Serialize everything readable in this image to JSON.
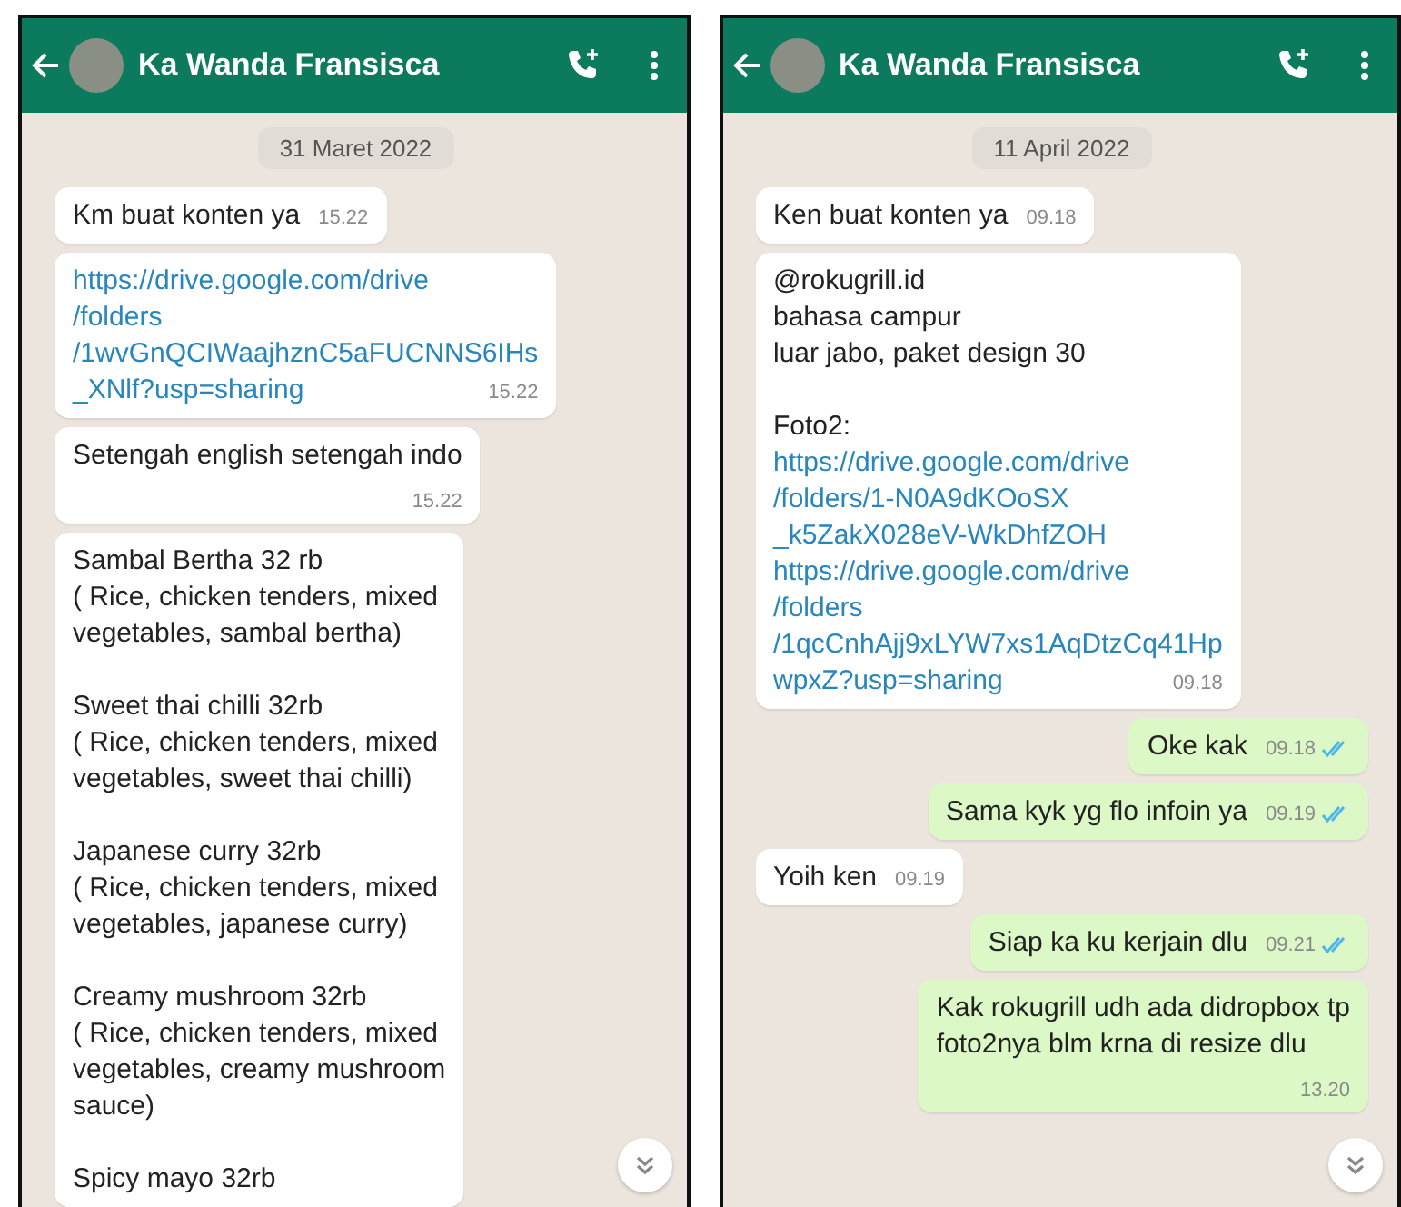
{
  "panels": [
    {
      "header": {
        "title": "Ka Wanda Fransisca"
      },
      "date": "31 Maret 2022",
      "messages": [
        {
          "kind": "incoming",
          "time": "15.22",
          "paragraphs": [
            [
              {
                "kind": "text",
                "text": "Km buat konten ya"
              }
            ]
          ]
        },
        {
          "kind": "incoming",
          "time": "15.22",
          "paragraphs": [
            [
              {
                "kind": "link",
                "text": "https://drive.google.com/drive"
              },
              {
                "kind": "link",
                "text": "/folders"
              },
              {
                "kind": "link",
                "text": "/1wvGnQCIWaajhznC5aFUCNNS6IHs"
              },
              {
                "kind": "link",
                "text": "_XNlf?usp=sharing"
              }
            ]
          ]
        },
        {
          "kind": "incoming",
          "time": "15.22",
          "time_below": true,
          "paragraphs": [
            [
              {
                "kind": "text",
                "text": "Setengah english setengah indo"
              }
            ]
          ]
        },
        {
          "kind": "incoming",
          "paragraphs": [
            [
              {
                "kind": "text",
                "text": "Sambal Bertha  32 rb"
              },
              {
                "kind": "text",
                "text": "( Rice, chicken tenders, mixed"
              },
              {
                "kind": "text",
                "text": "vegetables, sambal bertha)"
              }
            ],
            [
              {
                "kind": "text",
                "text": "Sweet thai chilli  32rb"
              },
              {
                "kind": "text",
                "text": "( Rice, chicken tenders, mixed"
              },
              {
                "kind": "text",
                "text": "vegetables, sweet thai chilli)"
              }
            ],
            [
              {
                "kind": "text",
                "text": "Japanese curry 32rb"
              },
              {
                "kind": "text",
                "text": "( Rice, chicken tenders, mixed"
              },
              {
                "kind": "text",
                "text": "vegetables, japanese curry)"
              }
            ],
            [
              {
                "kind": "text",
                "text": "Creamy mushroom 32rb"
              },
              {
                "kind": "text",
                "text": "( Rice, chicken tenders, mixed"
              },
              {
                "kind": "text",
                "text": "vegetables,  creamy mushroom"
              },
              {
                "kind": "text",
                "text": "sauce)"
              }
            ],
            [
              {
                "kind": "text",
                "text": "Spicy mayo 32rb"
              }
            ]
          ]
        }
      ]
    },
    {
      "header": {
        "title": "Ka Wanda Fransisca"
      },
      "date": "11 April 2022",
      "messages": [
        {
          "kind": "incoming",
          "time": "09.18",
          "paragraphs": [
            [
              {
                "kind": "text",
                "text": "Ken buat konten ya"
              }
            ]
          ]
        },
        {
          "kind": "incoming",
          "time": "09.18",
          "paragraphs": [
            [
              {
                "kind": "text",
                "text": "@rokugrill.id"
              },
              {
                "kind": "text",
                "text": "bahasa campur"
              },
              {
                "kind": "text",
                "text": "luar jabo, paket design 30"
              }
            ],
            [
              {
                "kind": "text",
                "text": "Foto2:"
              },
              {
                "kind": "link",
                "text": "https://drive.google.com/drive"
              },
              {
                "kind": "link",
                "text": "/folders/1-N0A9dKOoSX"
              },
              {
                "kind": "link",
                "text": "_k5ZakX028eV-WkDhfZOH"
              },
              {
                "kind": "link",
                "text": "https://drive.google.com/drive"
              },
              {
                "kind": "link",
                "text": "/folders"
              },
              {
                "kind": "link",
                "text": "/1qcCnhAjj9xLYW7xs1AqDtzCq41Hp"
              },
              {
                "kind": "link",
                "text": "wpxZ?usp=sharing"
              }
            ]
          ]
        },
        {
          "kind": "outgoing",
          "time": "09.18",
          "read": true,
          "paragraphs": [
            [
              {
                "kind": "text",
                "text": "Oke kak"
              }
            ]
          ]
        },
        {
          "kind": "outgoing",
          "time": "09.19",
          "read": true,
          "paragraphs": [
            [
              {
                "kind": "text",
                "text": "Sama kyk yg flo infoin ya"
              }
            ]
          ]
        },
        {
          "kind": "incoming",
          "time": "09.19",
          "paragraphs": [
            [
              {
                "kind": "text",
                "text": "Yoih ken"
              }
            ]
          ]
        },
        {
          "kind": "outgoing",
          "time": "09.21",
          "read": true,
          "paragraphs": [
            [
              {
                "kind": "text",
                "text": "Siap ka ku kerjain dlu"
              }
            ]
          ]
        },
        {
          "kind": "outgoing",
          "time": "13.20",
          "time_below": true,
          "paragraphs": [
            [
              {
                "kind": "text",
                "text": "Kak rokugrill udh ada didropbox tp"
              },
              {
                "kind": "text",
                "text": "foto2nya blm krna di resize dlu"
              }
            ]
          ]
        }
      ]
    }
  ]
}
